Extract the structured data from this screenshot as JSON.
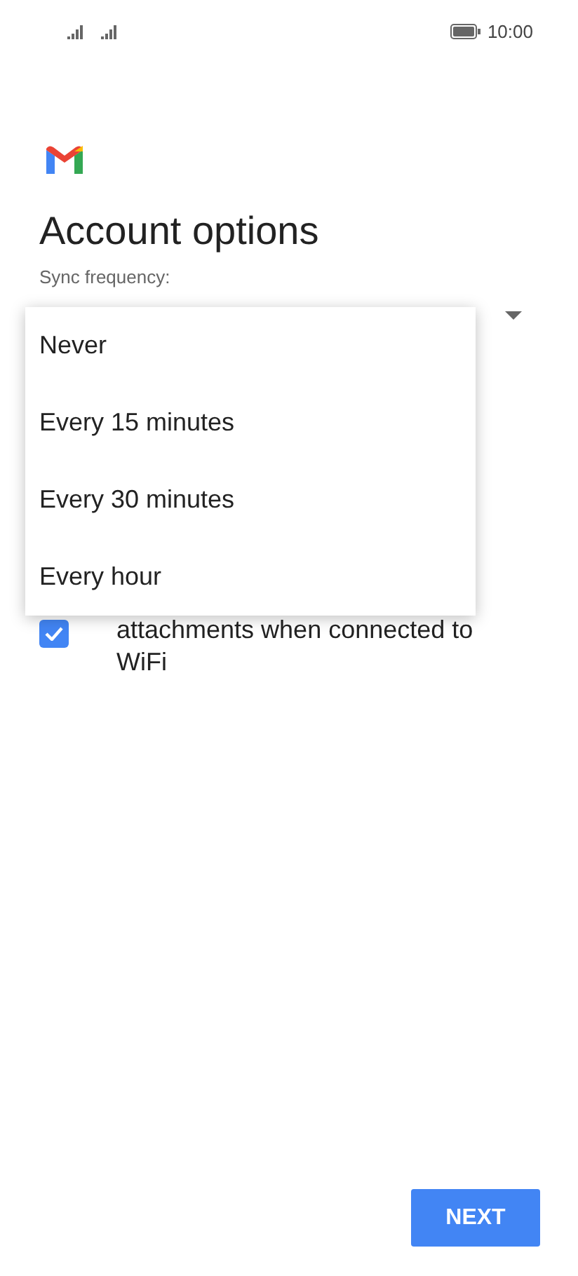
{
  "status_bar": {
    "time": "10:00"
  },
  "title": "Account options",
  "sync": {
    "label": "Sync frequency:"
  },
  "menu": {
    "options": [
      {
        "label": "Never"
      },
      {
        "label": "Every 15 minutes"
      },
      {
        "label": "Every 30 minutes"
      },
      {
        "label": "Every hour"
      }
    ]
  },
  "checkbox": {
    "lines": [
      "attachments when connected to",
      "WiFi"
    ],
    "checked": true
  },
  "next_button": "NEXT"
}
